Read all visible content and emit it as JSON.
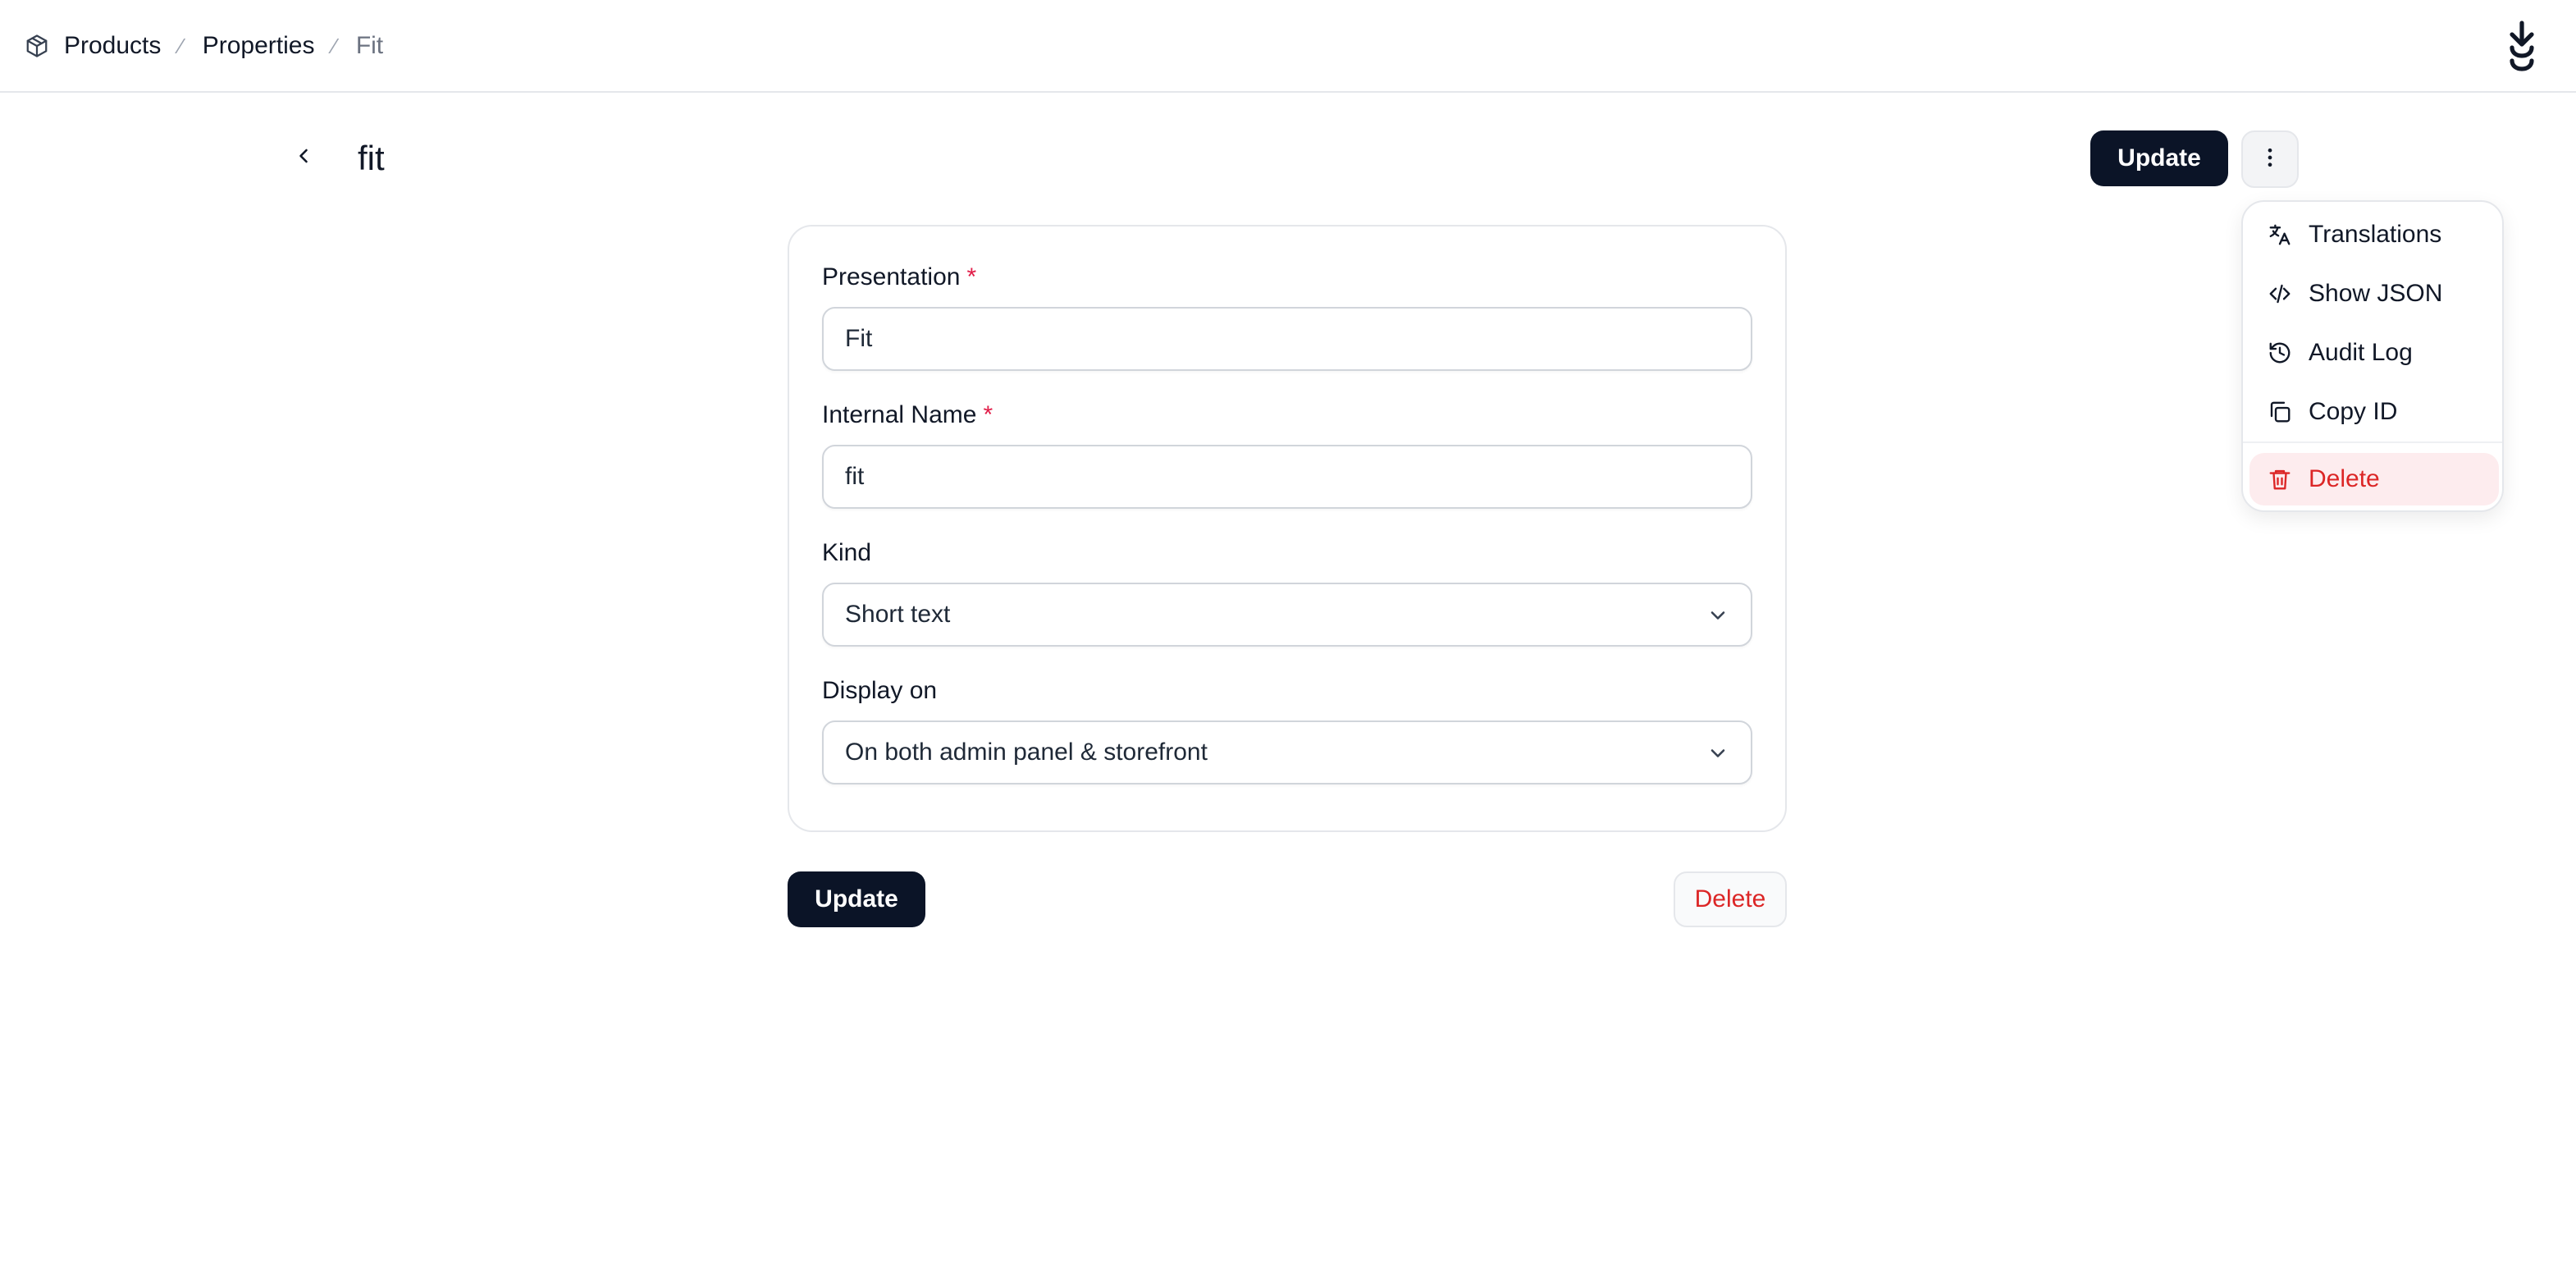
{
  "breadcrumb": {
    "icon": "package-icon",
    "items": [
      {
        "label": "Products"
      },
      {
        "label": "Properties"
      },
      {
        "label": "Fit"
      }
    ],
    "separator": "⁄"
  },
  "logo": {
    "icon": "brand-logo-icon"
  },
  "header": {
    "back_icon": "chevron-left-icon",
    "title": "fit",
    "update_label": "Update",
    "more_icon": "more-vertical-icon"
  },
  "menu": {
    "items": [
      {
        "label": "Translations",
        "icon": "translate-icon"
      },
      {
        "label": "Show JSON",
        "icon": "code-icon"
      },
      {
        "label": "Audit Log",
        "icon": "history-icon"
      },
      {
        "label": "Copy ID",
        "icon": "copy-icon"
      },
      {
        "label": "Delete",
        "icon": "trash-icon",
        "danger": true
      }
    ]
  },
  "form": {
    "presentation": {
      "label": "Presentation",
      "required_mark": "*",
      "value": "Fit"
    },
    "internal_name": {
      "label": "Internal Name",
      "required_mark": "*",
      "value": "fit"
    },
    "kind": {
      "label": "Kind",
      "value": "Short text"
    },
    "display_on": {
      "label": "Display on",
      "value": "On both admin panel & storefront"
    }
  },
  "actions": {
    "update_label": "Update",
    "delete_label": "Delete"
  },
  "colors": {
    "primary": "#0b1427",
    "danger": "#dc2626",
    "danger_bg": "#fdecee",
    "required": "#e11d48",
    "border": "#e5e7eb"
  }
}
